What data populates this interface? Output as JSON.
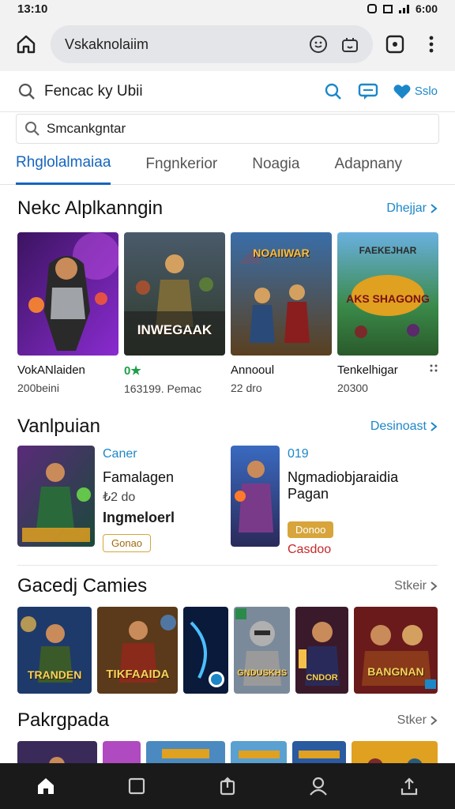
{
  "status": {
    "time": "13:10",
    "right_text": "6:00"
  },
  "browser": {
    "url": "Vskaknolaiim"
  },
  "site_header": {
    "search_text": "Fencac ky Ubii",
    "right_label": "Sslo"
  },
  "search": {
    "value": "Smcankgntar"
  },
  "tabs": [
    {
      "label": "Rhglolalmaiaa"
    },
    {
      "label": "Fngnkerior"
    },
    {
      "label": "Noagia"
    },
    {
      "label": "Adapnany"
    }
  ],
  "section1": {
    "title": "Nekc Alplkanngin",
    "link": "Dhejjar",
    "cards": [
      {
        "title": "VokANlaiden",
        "sub": "200beini",
        "art_label": "",
        "badge": ""
      },
      {
        "title": "",
        "rating": "0★",
        "sub": "163199. Pemac",
        "art_label": "INWEGAAK",
        "badge": ""
      },
      {
        "title": "Annooul",
        "sub": "22 dro",
        "art_label": "NOAIIWAR",
        "badge": ""
      },
      {
        "title": "Tenkelhigar",
        "sub": "20300",
        "art_label": "AKS SHAGONG",
        "badge": "FAEKEJHAR"
      }
    ]
  },
  "section2": {
    "title": "Vanlpuian",
    "link": "Desinoast",
    "items": [
      {
        "category": "Caner",
        "name": "Famalagen",
        "price": "₺2 do",
        "name2": "Ingmeloerl",
        "pill": "Gonao"
      },
      {
        "category": "019",
        "name": "Ngmadiobjaraidia Pagan",
        "pill": "Donoo",
        "red": "Casdoo"
      }
    ]
  },
  "section3": {
    "title": "Gacedj Camies",
    "link": "Stkeir",
    "tiles": [
      {
        "label": "TRANDEN"
      },
      {
        "label": "TIKFAAIDA"
      },
      {
        "label": ""
      },
      {
        "label": "GNDUSKHS"
      },
      {
        "label": "CNDOR"
      },
      {
        "label": "BANGNAN"
      }
    ]
  },
  "section4": {
    "title": "Pakrgpada",
    "link": "Stker"
  },
  "nav": {
    "items": [
      {
        "icon": "home-icon"
      },
      {
        "icon": "square-icon"
      },
      {
        "icon": "share-box-icon"
      },
      {
        "icon": "profile-icon"
      },
      {
        "icon": "upload-icon"
      }
    ]
  }
}
